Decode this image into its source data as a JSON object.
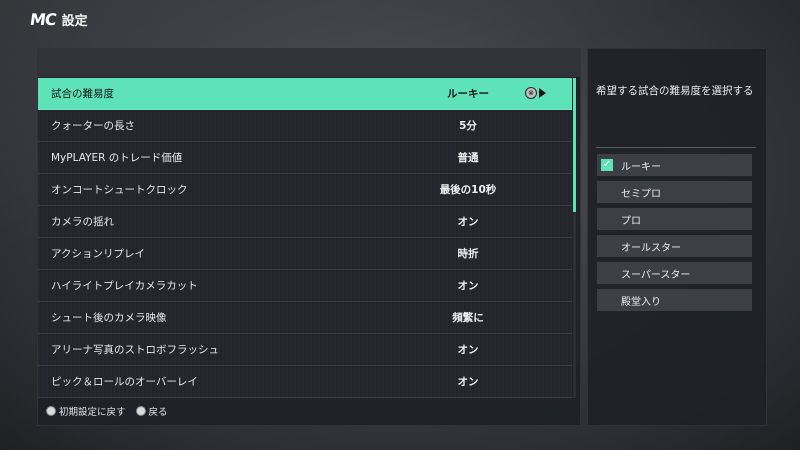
{
  "header": {
    "logo": "MC",
    "title": "設定"
  },
  "settings": {
    "rows": [
      {
        "label": "試合の難易度",
        "value": "ルーキー",
        "selected": true
      },
      {
        "label": "クォーターの長さ",
        "value": "5分"
      },
      {
        "label": "MyPLAYER のトレード価値",
        "value": "普通"
      },
      {
        "label": "オンコートシュートクロック",
        "value": "最後の10秒"
      },
      {
        "label": "カメラの揺れ",
        "value": "オン"
      },
      {
        "label": "アクションリプレイ",
        "value": "時折"
      },
      {
        "label": "ハイライトプレイカメラカット",
        "value": "オン"
      },
      {
        "label": "シュート後のカメラ映像",
        "value": "頻繁に"
      },
      {
        "label": "アリーナ写真のストロボフラッシュ",
        "value": "オン"
      },
      {
        "label": "ピック＆ロールのオーバーレイ",
        "value": "オン"
      }
    ],
    "selected_icon": "⊗",
    "accent_color": "#5ee3b9"
  },
  "footer": {
    "reset_label": "初期設定に戻す",
    "back_label": "戻る"
  },
  "detail": {
    "description": "希望する試合の難易度を選択する",
    "options": [
      {
        "label": "ルーキー",
        "checked": true
      },
      {
        "label": "セミプロ"
      },
      {
        "label": "プロ"
      },
      {
        "label": "オールスター"
      },
      {
        "label": "スーパースター"
      },
      {
        "label": "殿堂入り"
      }
    ]
  }
}
